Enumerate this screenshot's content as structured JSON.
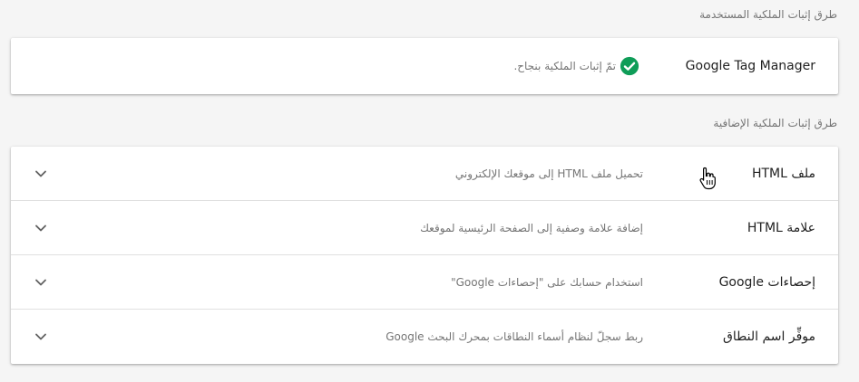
{
  "used_methods": {
    "label": "طرق إثبات الملكية المستخدمة",
    "card": {
      "title": "Google Tag Manager",
      "status": "تمّ إثبات الملكية بنجاح.",
      "status_icon": "check-circle-icon",
      "status_color": "#0f9d58"
    }
  },
  "additional_methods": {
    "label": "طرق إثبات الملكية الإضافية",
    "items": [
      {
        "title": "ملف HTML",
        "description": "تحميل ملف HTML إلى موقعك الإلكتروني",
        "icon": "chevron-down-icon"
      },
      {
        "title": "علامة HTML",
        "description": "إضافة علامة وصفية إلى الصفحة الرئيسية لموقعك",
        "icon": "chevron-down-icon"
      },
      {
        "title": "إحصاءات Google",
        "description": "استخدام حسابك على \"إحصاءات Google\"",
        "icon": "chevron-down-icon"
      },
      {
        "title": "موفِّر اسم النطاق",
        "description": "ربط سجلّ لنظام أسماء النطاقات بمحرك البحث Google",
        "icon": "chevron-down-icon"
      }
    ]
  },
  "colors": {
    "background": "#f5f5f5",
    "card": "#ffffff",
    "primary_text": "#212121",
    "secondary_text": "#757575",
    "divider": "#e0e0e0"
  }
}
